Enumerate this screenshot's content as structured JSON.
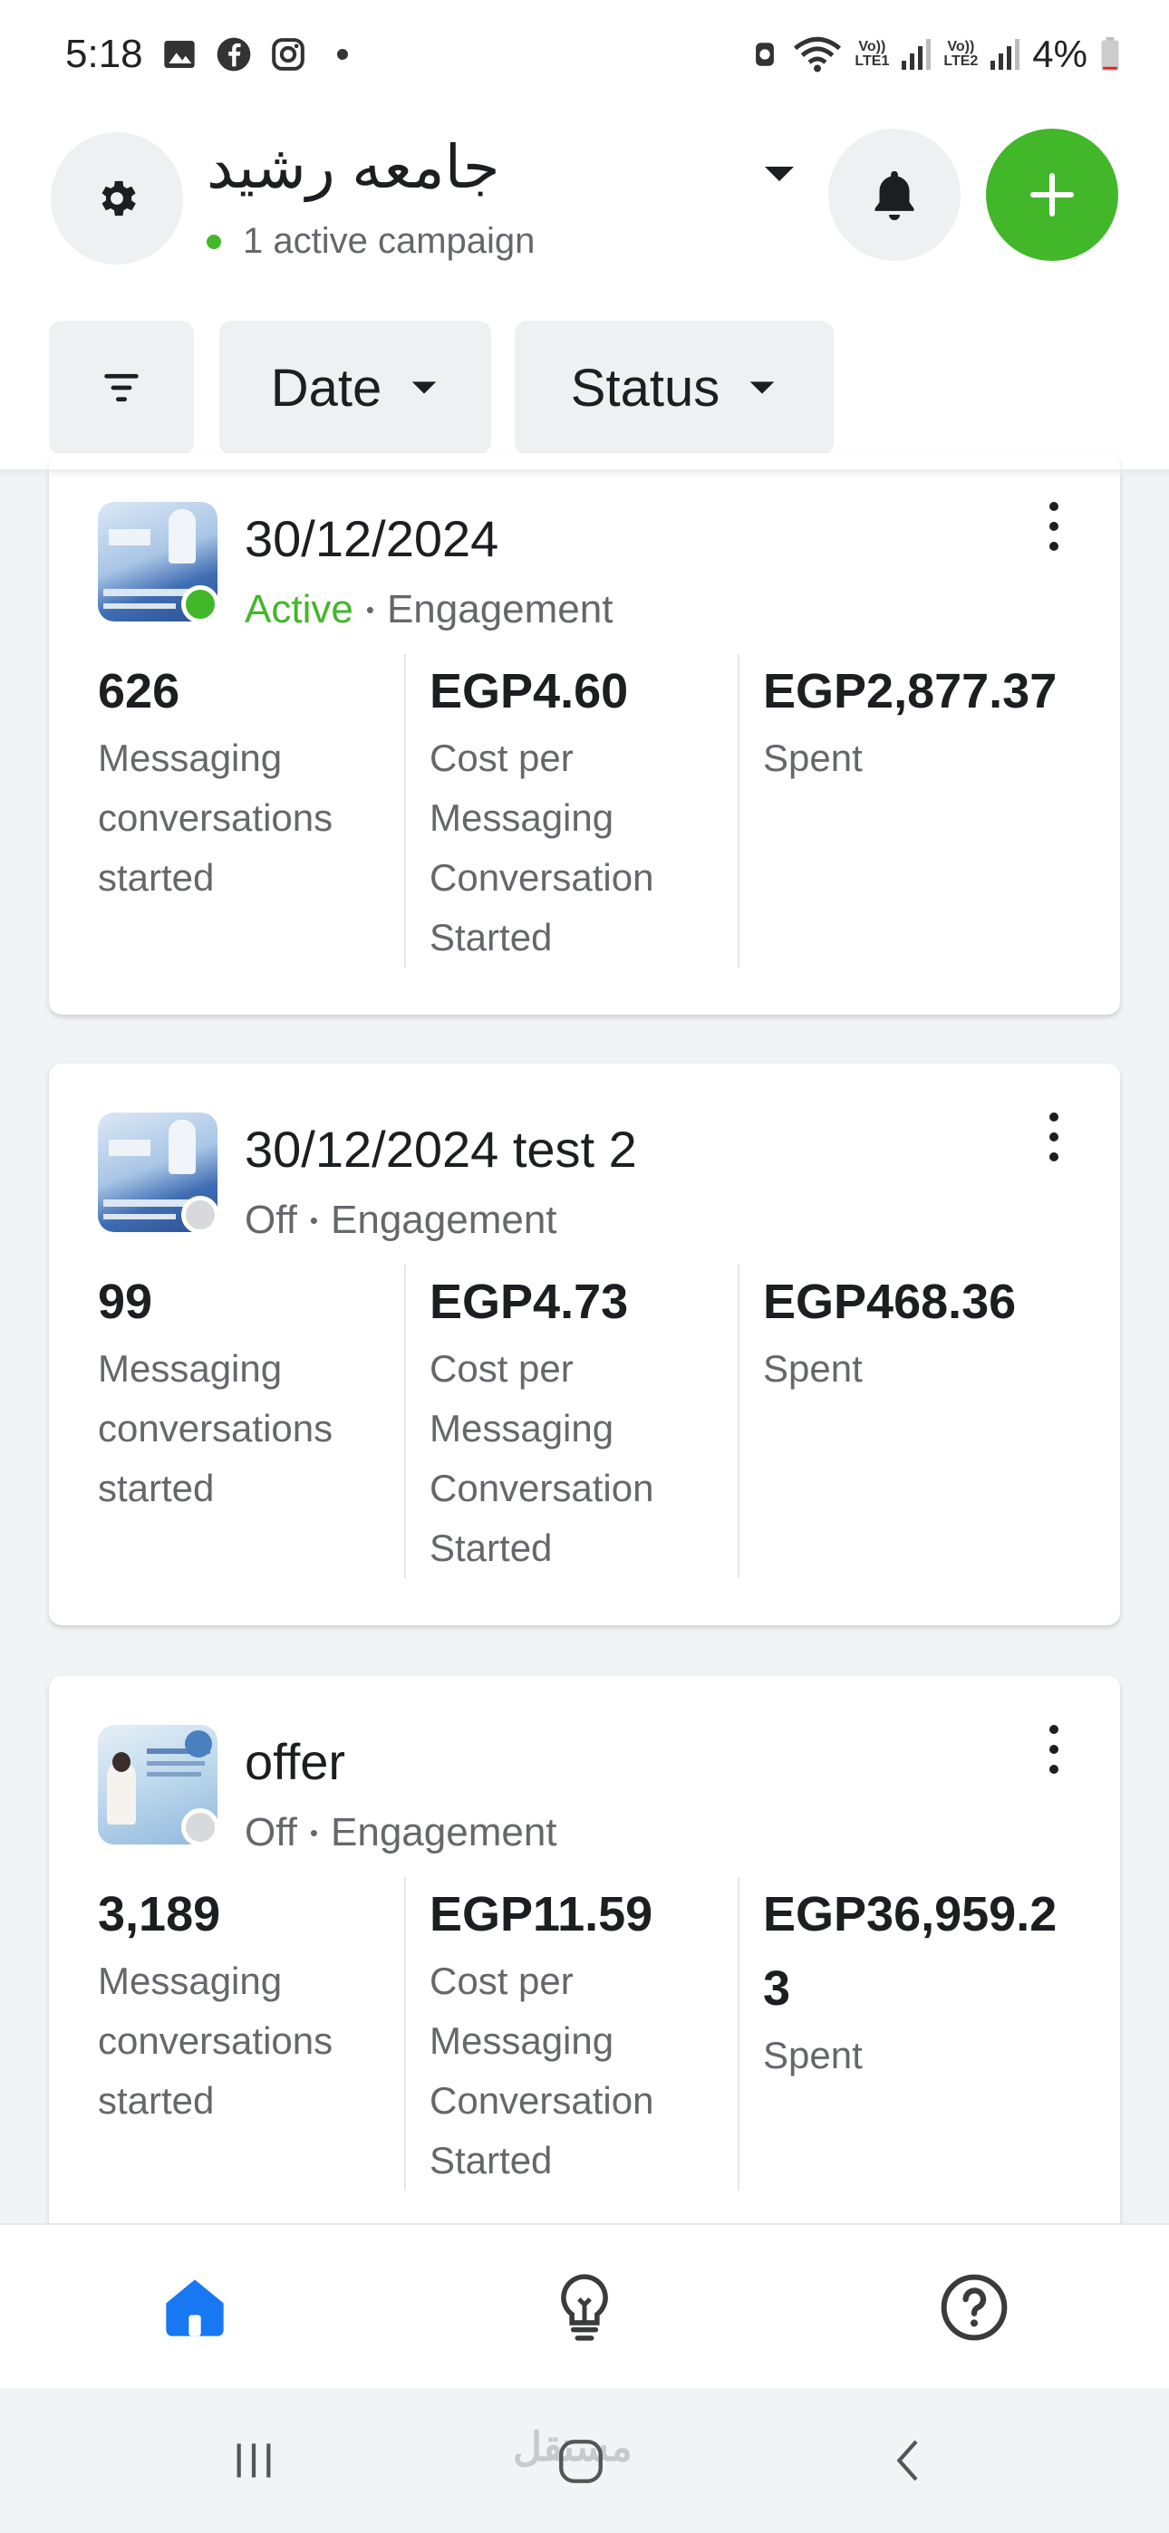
{
  "status_bar": {
    "time": "5:18",
    "battery": "4%",
    "network1": "LTE1",
    "network2": "LTE2",
    "volte": "Vo))"
  },
  "header": {
    "account_name": "جامعه رشيد",
    "active_campaigns": "1 active campaign"
  },
  "filters": {
    "date_label": "Date",
    "status_label": "Status"
  },
  "campaigns": [
    {
      "name": "30/12/2024",
      "status": "Active",
      "objective": "Engagement",
      "results_value": "626",
      "results_label": "Messaging conversations started",
      "cost_value": "EGP4.60",
      "cost_label": "Cost per Messaging Conversation Started",
      "spent_value": "EGP2,877.37",
      "spent_label": "Spent"
    },
    {
      "name": "30/12/2024 test 2",
      "status": "Off",
      "objective": "Engagement",
      "results_value": "99",
      "results_label": "Messaging conversations started",
      "cost_value": "EGP4.73",
      "cost_label": "Cost per Messaging Conversation Started",
      "spent_value": "EGP468.36",
      "spent_label": "Spent"
    },
    {
      "name": "offer",
      "status": "Off",
      "objective": "Engagement",
      "results_value": "3,189",
      "results_label": "Messaging conversations started",
      "cost_value": "EGP11.59",
      "cost_label": "Cost per Messaging Conversation Started",
      "spent_value": "EGP36,959.23",
      "spent_label": "Spent"
    }
  ],
  "separator": "•",
  "watermark": "مستقل",
  "colors": {
    "accent_green": "#42b72a",
    "nav_active_blue": "#1877f2",
    "secondary_text": "#65676b"
  }
}
